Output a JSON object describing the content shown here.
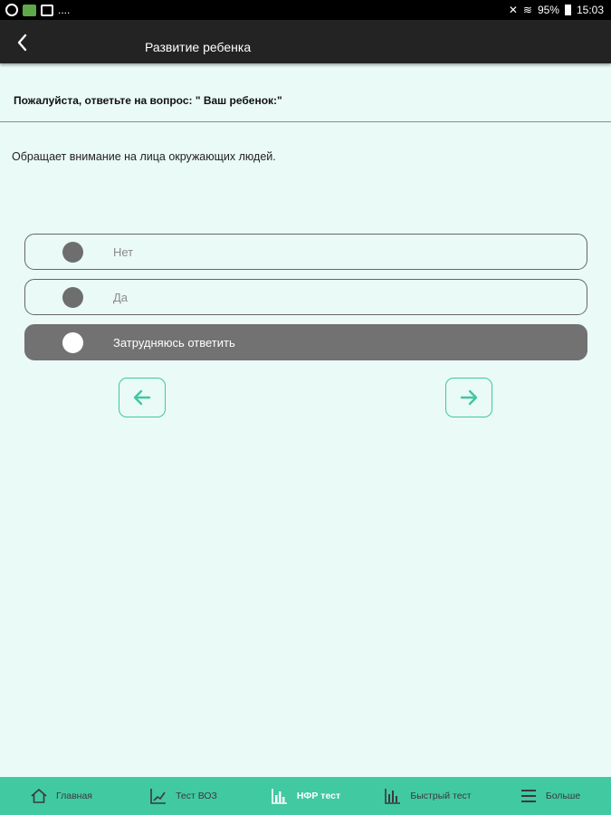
{
  "status_bar": {
    "left_glyphs": "....",
    "battery": "95%",
    "time": "15:03"
  },
  "header": {
    "title": "Развитие ребенка"
  },
  "prompt": "Пожалуйста, ответьте на вопрос: \" Ваш ребенок:\"",
  "question": "Обращает внимание на лица окружающих людей.",
  "options": [
    {
      "label": "Нет",
      "selected": false
    },
    {
      "label": "Да",
      "selected": false
    },
    {
      "label": "Затрудняюсь ответить",
      "selected": true
    }
  ],
  "colors": {
    "accent": "#41c9a2",
    "appbar": "#232323",
    "background": "#eafaf6",
    "selected_option": "#727272"
  },
  "tabs": [
    {
      "label": "Главная",
      "icon": "home-icon",
      "active": false
    },
    {
      "label": "Тест ВОЗ",
      "icon": "chart-icon",
      "active": false
    },
    {
      "label": "НФР тест",
      "icon": "bar-chart-icon",
      "active": true
    },
    {
      "label": "Быстрый тест",
      "icon": "bar-chart-icon",
      "active": false
    },
    {
      "label": "Больше",
      "icon": "menu-icon",
      "active": false
    }
  ]
}
